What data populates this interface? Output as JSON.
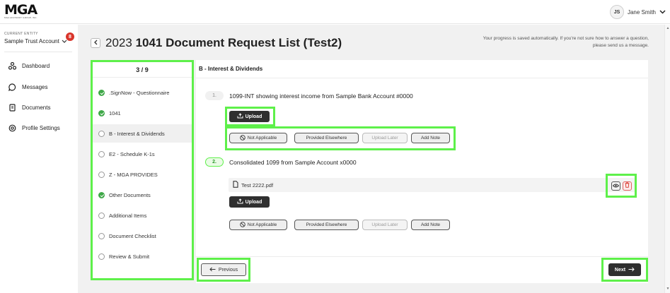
{
  "header": {
    "logo": "MGA",
    "logo_subtitle": "MGA ADVISORY GROUP, INC.",
    "user_initials": "JS",
    "user_name": "Jane Smith"
  },
  "sidebar": {
    "entity_label": "CURRENT ENTITY",
    "entity_name": "Sample Trust Account",
    "notification_count": "8",
    "items": [
      {
        "label": "Dashboard",
        "icon": "dashboard-icon"
      },
      {
        "label": "Messages",
        "icon": "message-icon"
      },
      {
        "label": "Documents",
        "icon": "documents-icon"
      },
      {
        "label": "Profile Settings",
        "icon": "profile-settings-icon"
      }
    ]
  },
  "page": {
    "title_prefix": "2023",
    "title_bold": "1041 Document Request List (Test2)",
    "save_note": "Your progress is saved automatically. If you're not sure how to answer a question, please send us a message."
  },
  "steps": {
    "progress": "3 / 9",
    "items": [
      {
        "label": ".SignNow - Questionnaire",
        "status": "done"
      },
      {
        "label": "1041",
        "status": "done"
      },
      {
        "label": "B - Interest & Dividends",
        "status": "active"
      },
      {
        "label": "E2 - Schedule K-1s",
        "status": "pending"
      },
      {
        "label": "Z - MGA PROVIDES",
        "status": "pending"
      },
      {
        "label": "Other Documents",
        "status": "done"
      },
      {
        "label": "Additional Items",
        "status": "pending"
      },
      {
        "label": "Document Checklist",
        "status": "pending"
      },
      {
        "label": "Review & Submit",
        "status": "pending"
      }
    ]
  },
  "section": {
    "title": "B - Interest & Dividends",
    "questions": [
      {
        "number": "1.",
        "text": "1099-INT showing interest income from Sample Bank Account #0000",
        "upload_label": "Upload",
        "actions": [
          "Not Applicable",
          "Provided Elsewhere",
          "Upload Later",
          "Add Note"
        ]
      },
      {
        "number": "2.",
        "text": "Consolidated 1099 from Sample Account x0000",
        "file_name": "Test 2222.pdf",
        "upload_label": "Upload",
        "actions": [
          "Not Applicable",
          "Provided Elsewhere",
          "Upload Later",
          "Add Note"
        ]
      }
    ]
  },
  "footer": {
    "previous_label": "Previous",
    "next_label": "Next"
  },
  "colors": {
    "highlight": "#5ef04a",
    "done": "#3fa848",
    "badge": "#d9352b",
    "dark_button": "#2f2f2f"
  }
}
